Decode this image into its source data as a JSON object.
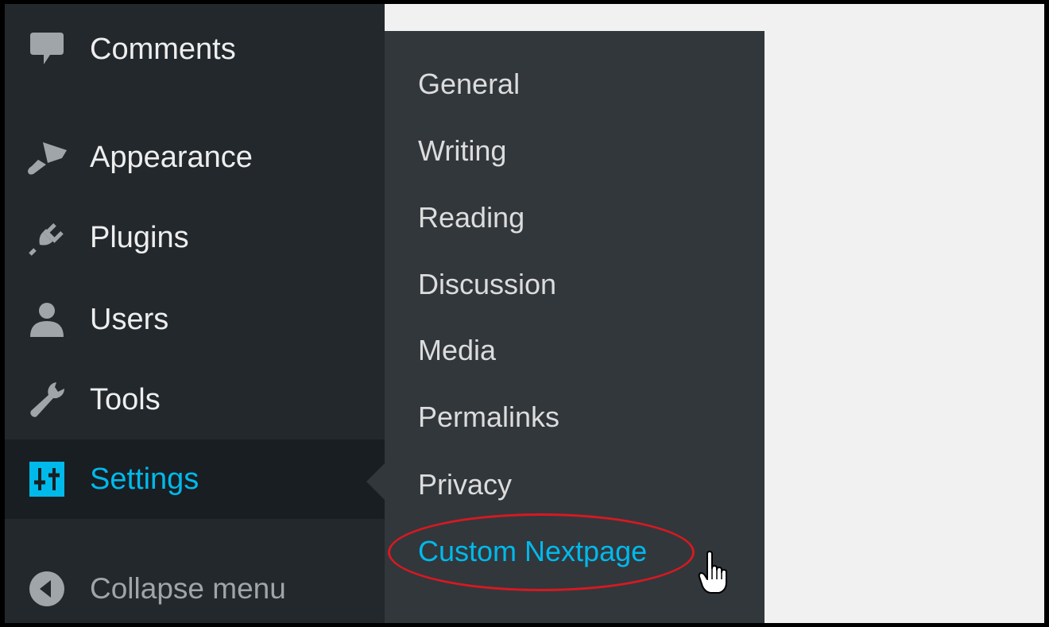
{
  "sidebar": {
    "items": [
      {
        "label": "Comments",
        "icon": "comment-icon"
      },
      {
        "label": "Appearance",
        "icon": "paintbrush-icon"
      },
      {
        "label": "Plugins",
        "icon": "plug-icon"
      },
      {
        "label": "Users",
        "icon": "user-icon"
      },
      {
        "label": "Tools",
        "icon": "wrench-icon"
      },
      {
        "label": "Settings",
        "icon": "settings-sliders-icon",
        "current": true
      },
      {
        "label": "Collapse menu",
        "icon": "collapse-arrow-icon"
      }
    ]
  },
  "submenu": {
    "items": [
      {
        "label": "General"
      },
      {
        "label": "Writing"
      },
      {
        "label": "Reading"
      },
      {
        "label": "Discussion"
      },
      {
        "label": "Media"
      },
      {
        "label": "Permalinks"
      },
      {
        "label": "Privacy"
      },
      {
        "label": "Custom Nextpage",
        "highlighted": true
      }
    ]
  },
  "colors": {
    "sidebar_bg": "#23282d",
    "submenu_bg": "#32373c",
    "accent": "#00b9eb",
    "annotation_ring": "#d71920",
    "content_bg": "#f1f1f1"
  }
}
